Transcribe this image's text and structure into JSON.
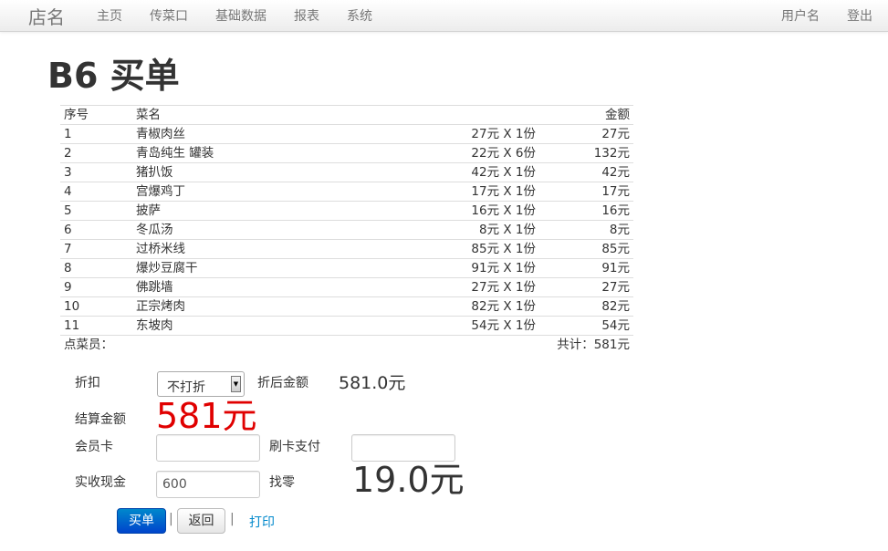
{
  "navbar": {
    "brand": "店名",
    "items": [
      "主页",
      "传菜口",
      "基础数据",
      "报表",
      "系统"
    ],
    "user": "用户名",
    "logout": "登出"
  },
  "page": {
    "title": "B6 买单"
  },
  "bill": {
    "headers": {
      "index": "序号",
      "name": "菜名",
      "qty": "",
      "amount": "金额"
    },
    "rows": [
      {
        "index": "1",
        "name": "青椒肉丝",
        "qty": "27元 X 1份",
        "amount": "27元"
      },
      {
        "index": "2",
        "name": "青岛纯生 罐装",
        "qty": "22元 X 6份",
        "amount": "132元"
      },
      {
        "index": "3",
        "name": "猪扒饭",
        "qty": "42元 X 1份",
        "amount": "42元"
      },
      {
        "index": "4",
        "name": "宫爆鸡丁",
        "qty": "17元 X 1份",
        "amount": "17元"
      },
      {
        "index": "5",
        "name": "披萨",
        "qty": "16元 X 1份",
        "amount": "16元"
      },
      {
        "index": "6",
        "name": "冬瓜汤",
        "qty": "8元 X 1份",
        "amount": "8元"
      },
      {
        "index": "7",
        "name": "过桥米线",
        "qty": "85元 X 1份",
        "amount": "85元"
      },
      {
        "index": "8",
        "name": "爆炒豆腐干",
        "qty": "91元 X 1份",
        "amount": "91元"
      },
      {
        "index": "9",
        "name": "佛跳墙",
        "qty": "27元 X 1份",
        "amount": "27元"
      },
      {
        "index": "10",
        "name": "正宗烤肉",
        "qty": "82元 X 1份",
        "amount": "82元"
      },
      {
        "index": "11",
        "name": "东坡肉",
        "qty": "54元 X 1份",
        "amount": "54元"
      }
    ],
    "footer": {
      "waiter": "点菜员：",
      "total": "共计：581元"
    }
  },
  "form": {
    "discount_label": "折扣",
    "discount_value": "不打折",
    "after_discount_label": "折后金额",
    "after_discount_value": "581.0元",
    "settle_label": "结算金额",
    "settle_value": "581元",
    "member_card_label": "会员卡",
    "member_card_value": "",
    "card_pay_label": "刷卡支付",
    "card_pay_value": "",
    "cash_label": "实收现金",
    "cash_value": "600",
    "change_label": "找零",
    "change_value": "19.0元"
  },
  "actions": {
    "checkout": "买单",
    "back": "返回",
    "separator": "|",
    "print": "打印"
  },
  "colors": {
    "accent": "#0088cc",
    "settle_red": "#e00000"
  }
}
